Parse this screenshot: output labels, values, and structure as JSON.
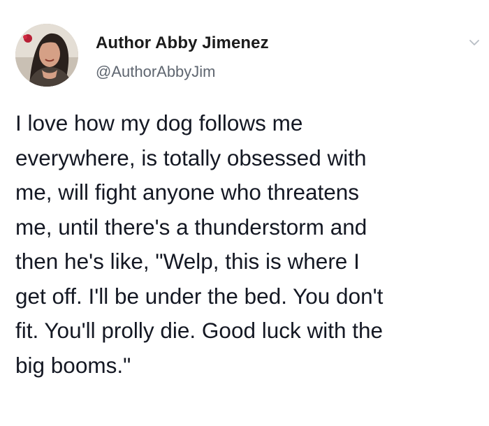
{
  "tweet": {
    "author": {
      "display_name": "Author Abby Jimenez",
      "handle": "@AuthorAbbyJim",
      "avatar_icon": "profile-photo"
    },
    "menu_icon": "chevron-down-icon",
    "text": "I love how my dog follows me\neverywhere, is totally obsessed with\nme, will fight anyone who threatens\nme, until there's a thunderstorm and\nthen he's like, \"Welp, this is where I\nget off. I'll be under the bed. You don't\nfit. You'll prolly die. Good luck with the\nbig booms.\""
  },
  "colors": {
    "background": "#ffffff",
    "text": "#141823",
    "handle": "#5f6670",
    "caret": "#b8bec5"
  }
}
